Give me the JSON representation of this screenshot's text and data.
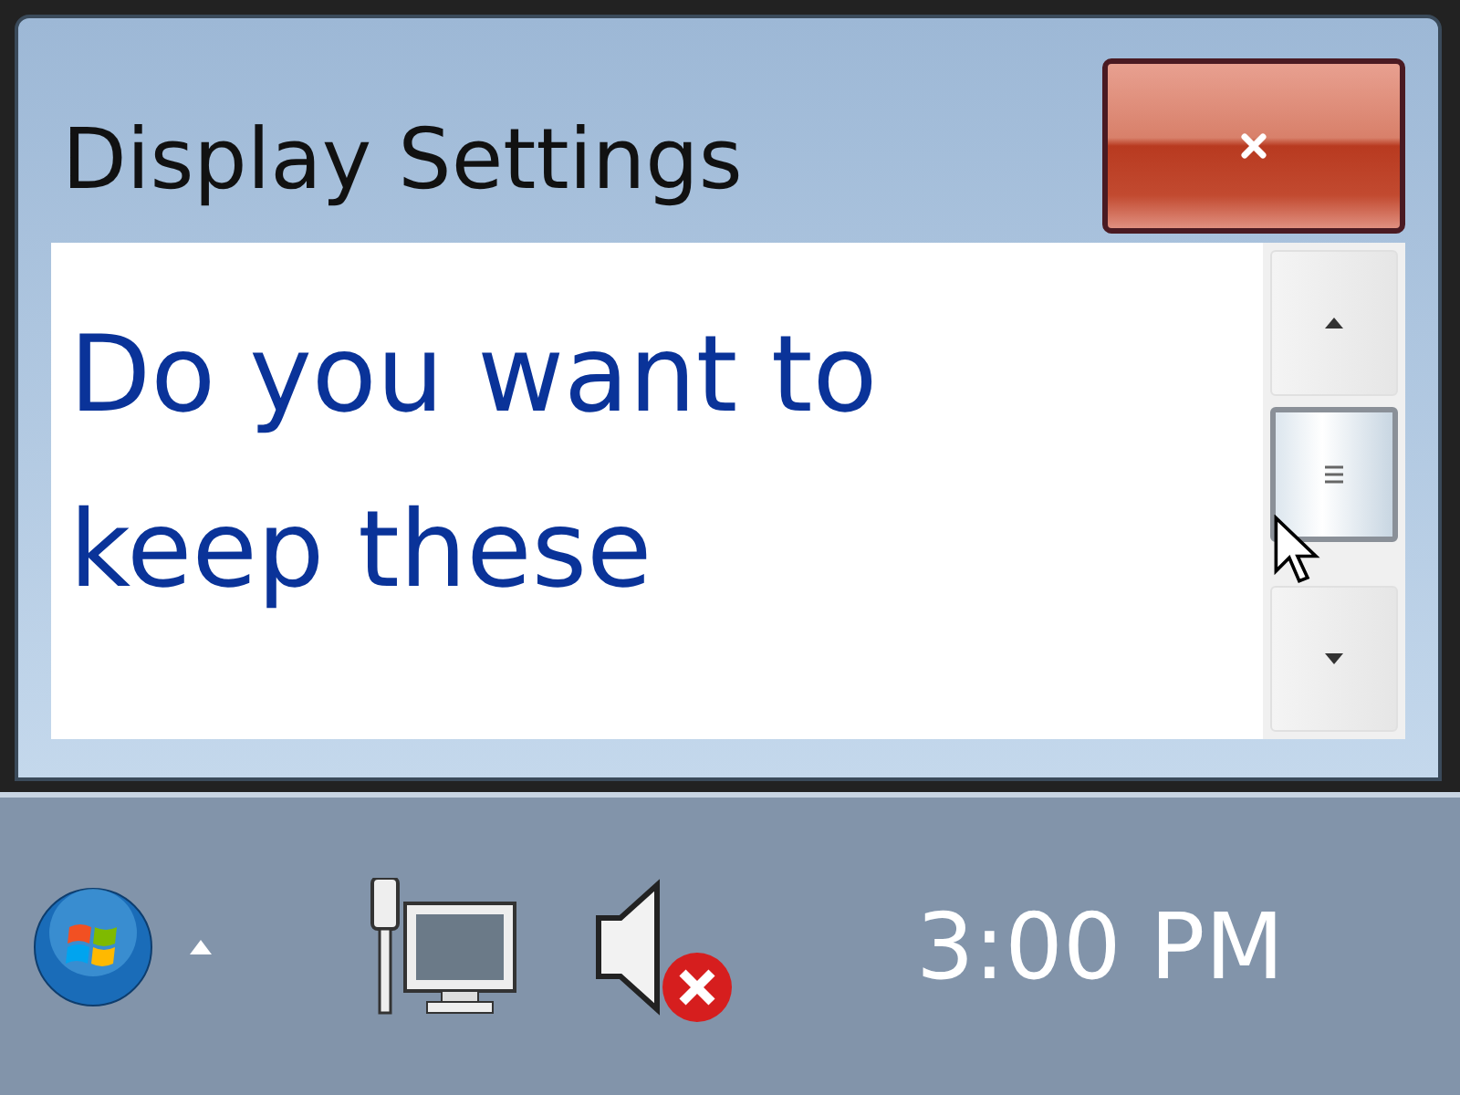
{
  "window": {
    "title": "Display Settings",
    "message": "Do you want to keep these"
  },
  "taskbar": {
    "tray": {
      "volume": {
        "muted": true
      }
    },
    "clock": "3:00 PM"
  }
}
